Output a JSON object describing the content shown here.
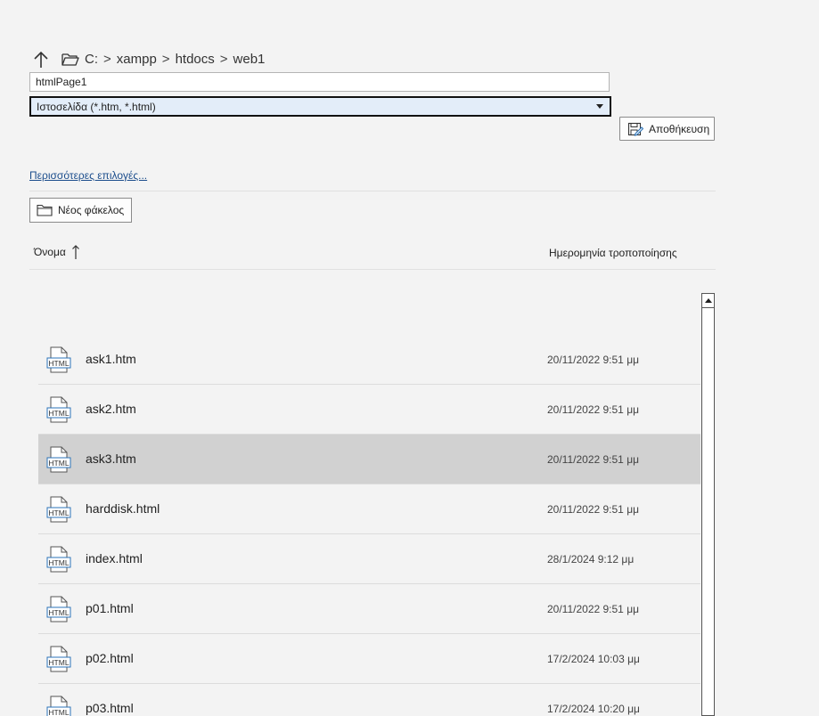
{
  "breadcrumb": {
    "items": [
      "C:",
      "xampp",
      "htdocs",
      "web1"
    ],
    "separator": ">"
  },
  "filename": {
    "value": "htmlPage1"
  },
  "filetype": {
    "selected": "Ιστοσελίδα (*.htm, *.html)"
  },
  "save_button": {
    "label": "Αποθήκευση"
  },
  "more_options": {
    "label": "Περισσότερες επιλογές..."
  },
  "new_folder_button": {
    "label": "Νέος φάκελος"
  },
  "columns": {
    "name": "Όνομα",
    "date": "Ημερομηνία τροποποίησης"
  },
  "files": [
    {
      "name": "ask1.htm",
      "date": "20/11/2022 9:51 μμ",
      "icon": "html-file-icon"
    },
    {
      "name": "ask2.htm",
      "date": "20/11/2022 9:51 μμ",
      "icon": "html-file-icon"
    },
    {
      "name": "ask3.htm",
      "date": "20/11/2022 9:51 μμ",
      "icon": "html-file-icon",
      "selected": true
    },
    {
      "name": "harddisk.html",
      "date": "20/11/2022 9:51 μμ",
      "icon": "html-file-icon"
    },
    {
      "name": "index.html",
      "date": "28/1/2024 9:12 μμ",
      "icon": "html-file-icon"
    },
    {
      "name": "p01.html",
      "date": "20/11/2022 9:51 μμ",
      "icon": "html-file-icon"
    },
    {
      "name": "p02.html",
      "date": "17/2/2024 10:03 μμ",
      "icon": "html-file-icon"
    },
    {
      "name": "p03.html",
      "date": "17/2/2024 10:20 μμ",
      "icon": "html-file-icon"
    }
  ],
  "file_icon_label": "HTML",
  "colors": {
    "background": "#f3f3f3",
    "select_bg": "#e3edf9",
    "selected_row": "#d1d1d1",
    "link": "#1b4d8c",
    "icon_accent": "#2b73b8"
  }
}
